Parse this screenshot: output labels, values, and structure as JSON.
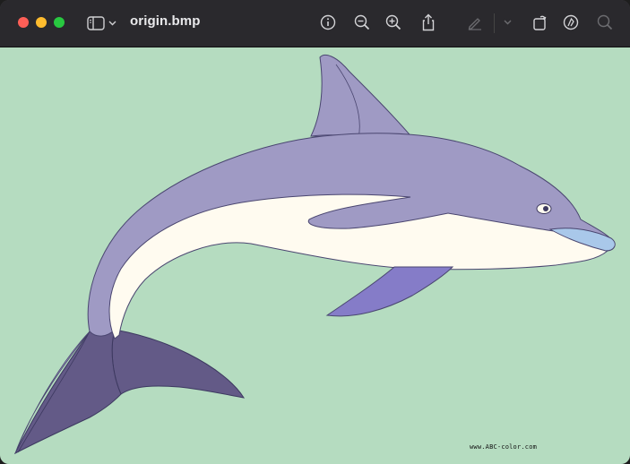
{
  "window": {
    "title": "origin.bmp"
  },
  "toolbar": {
    "icons": [
      "sidebar-icon",
      "chevron-down-icon",
      "info-icon",
      "zoom-out-icon",
      "zoom-in-icon",
      "share-icon",
      "markup-pen-icon",
      "chevron-down-icon",
      "rotate-icon",
      "markup-icon",
      "search-icon"
    ]
  },
  "image": {
    "watermark": "www.ABC-color.com"
  },
  "colors": {
    "background": "#b5dcc0",
    "dolphin_body": "#9f9ac4",
    "dolphin_belly": "#fffbf0",
    "fin": "#857cc8",
    "tail": "#635a87",
    "beak": "#a9c8ea"
  }
}
